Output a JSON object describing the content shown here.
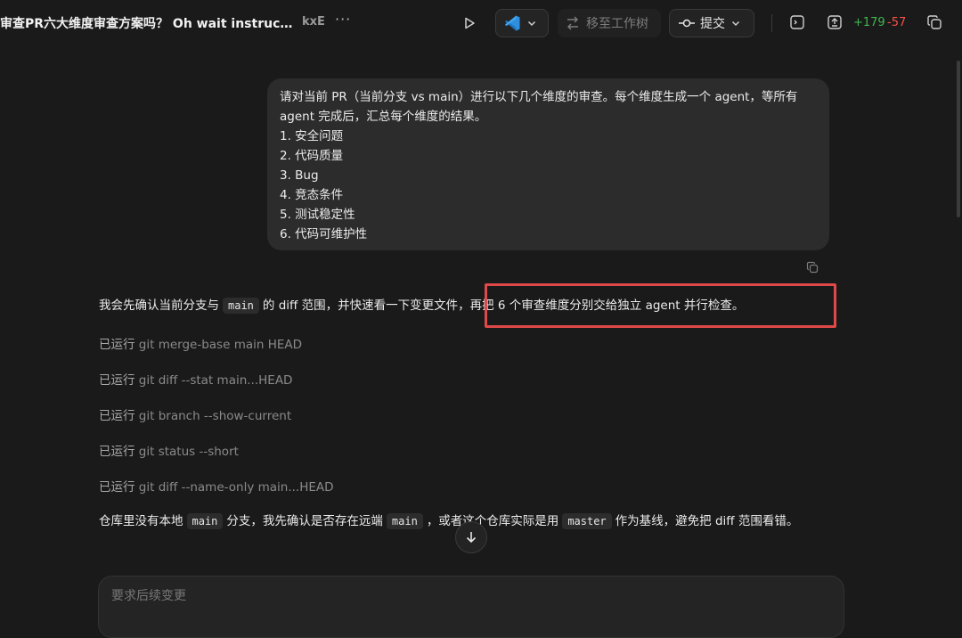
{
  "header": {
    "title": "审查PR六大维度审查方案吗？ Oh wait instructio...",
    "project": "kxE",
    "more": "···",
    "worktree_label": "移至工作树",
    "commit_label": "提交",
    "additions": "+179",
    "deletions": "-57"
  },
  "user_message": {
    "intro": "请对当前 PR（当前分支 vs main）进行以下几个维度的审查。每个维度生成一个 agent，等所有 agent 完成后，汇总每个维度的结果。",
    "items": [
      "1. 安全问题",
      "2. 代码质量",
      "3. Bug",
      "4. 竞态条件",
      "5. 测试稳定性",
      "6. 代码可维护性"
    ]
  },
  "assistant": {
    "msg1_a": "我会先确认当前分支与",
    "msg1_code": "main",
    "msg1_b": "的 diff 范围，并快速看一下变更文件，再把 6 个审查维度分别交给独立 agent 并行检查。",
    "ran_label": "已运行",
    "commands": [
      "git merge-base main HEAD",
      "git diff --stat main...HEAD",
      "git branch --show-current",
      "git status --short",
      "git diff --name-only main...HEAD"
    ],
    "msg2_a": "仓库里没有本地",
    "msg2_code1": "main",
    "msg2_b": "分支，我先确认是否存在远端",
    "msg2_code2": "main",
    "msg2_c": "，或者这个仓库实际是用",
    "msg2_code3": "master",
    "msg2_d": "作为基线，避免把 diff 范围看错。"
  },
  "composer": {
    "placeholder": "要求后续变更"
  },
  "colors": {
    "background": "#1a1a1a",
    "highlight_box": "#e0494a",
    "additions": "#3fb950",
    "deletions": "#f85149",
    "vscode_blue": "#2f8fde"
  },
  "icons": [
    "play-icon",
    "vscode-icon",
    "chevron-down-icon",
    "worktree-icon",
    "commit-icon",
    "terminal-icon",
    "diff-panel-icon",
    "copy-icon",
    "arrow-down-icon"
  ]
}
